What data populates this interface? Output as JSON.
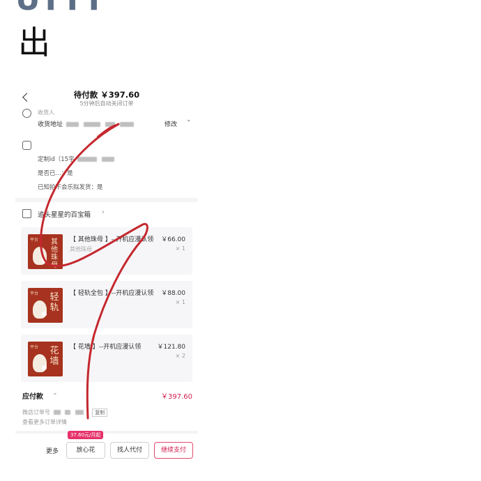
{
  "top_glyph": "UTTT",
  "big_char": "出",
  "header": {
    "title": "待付款 ￥397.60",
    "subtitle": "5分钟后自动关闭订单"
  },
  "address": {
    "label_top": "收货人",
    "label": "收货地址",
    "action": "修改"
  },
  "remarks": {
    "custom_id": "定制id（15字",
    "self_support": "是否已...：是",
    "ack_label": "已知拍下会乐拟发货：是"
  },
  "shop": {
    "name": "追头星星的百宝箱"
  },
  "products": [
    {
      "title": "【 其他珠母 】--开机应漫认领",
      "sub": "其他珠母",
      "price": "￥66.00",
      "qty": "× 1",
      "word": "其他珠母",
      "tag": "平台"
    },
    {
      "title": "【 轻轨全包 】--开机应漫认领",
      "sub": "",
      "price": "￥88.00",
      "qty": "× 1",
      "word": "轻轨",
      "tag": "平台"
    },
    {
      "title": "【 花墙 】--开机应漫认领",
      "sub": "",
      "price": "￥121.80",
      "qty": "× 2",
      "word": "花墙",
      "tag": "平台"
    }
  ],
  "payable": {
    "label": "应付款",
    "amount": "￥397.60"
  },
  "order": {
    "number_label": "微店订单号",
    "copy_label": "复制",
    "more_info": "查看更多订单详情"
  },
  "footer": {
    "more": "更多",
    "badge": "37.60元/月起",
    "btn_huabei": "放心花",
    "btn_friend": "找人代付",
    "btn_pay": "继续支付"
  },
  "colors": {
    "accent": "#d21e4e",
    "scribble": "#c4282e",
    "thumb_bg": "#a6321f"
  }
}
